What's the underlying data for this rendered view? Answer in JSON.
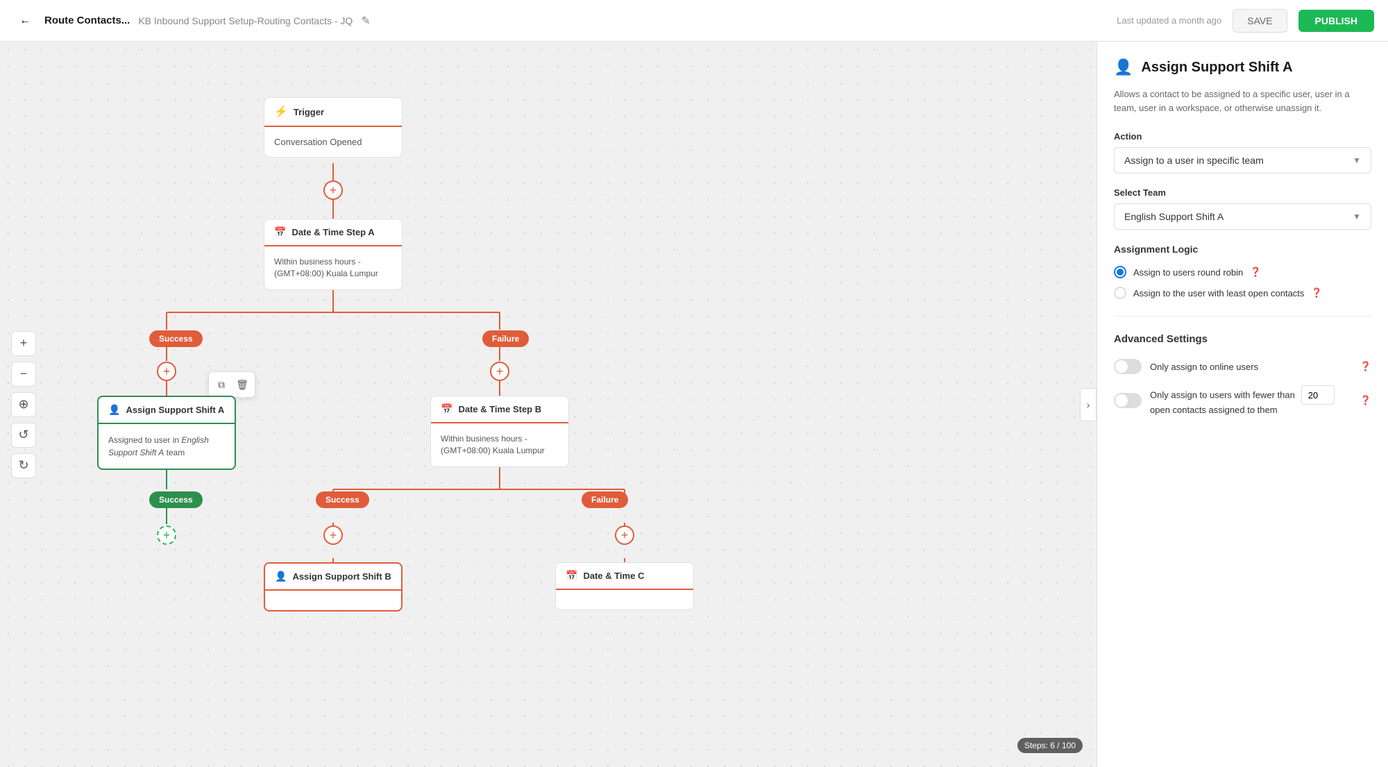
{
  "header": {
    "back_label": "←",
    "page_title": "Route Contacts...",
    "breadcrumb": "KB Inbound Support Setup-Routing Contacts - JQ",
    "edit_icon": "✎",
    "last_updated": "Last updated a month ago",
    "save_label": "SAVE",
    "publish_label": "PUBLISH"
  },
  "canvas": {
    "collapse_icon": "›",
    "steps": "Steps: 6 / 100",
    "toolbar": {
      "zoom_in": "+",
      "zoom_out": "−",
      "center": "⊕",
      "undo": "↺",
      "redo": "↻"
    }
  },
  "nodes": {
    "trigger": {
      "label": "Trigger",
      "body": "Conversation Opened"
    },
    "datetime_a": {
      "label": "Date & Time Step A",
      "body": "Within business hours - (GMT+08:00) Kuala Lumpur"
    },
    "assign_a": {
      "label": "Assign Support Shift A",
      "body_prefix": "Assigned to user in ",
      "body_italic": "English Support Shift A",
      "body_suffix": " team"
    },
    "datetime_b": {
      "label": "Date & Time Step B",
      "body": "Within business hours - (GMT+08:00) Kuala Lumpur"
    },
    "assign_b": {
      "label": "Assign Support Shift B",
      "body": ""
    },
    "datetime_c": {
      "label": "Date & Time C",
      "body": ""
    },
    "badges": {
      "success": "Success",
      "failure": "Failure",
      "success_green": "Success",
      "success2": "Success",
      "failure2": "Failure"
    }
  },
  "right_panel": {
    "icon": "👤",
    "title": "Assign Support Shift A",
    "description": "Allows a contact to be assigned to a specific user, user in a team, user in a workspace, or otherwise unassign it.",
    "action_label": "Action",
    "action_value": "Assign to a user in specific team",
    "select_team_label": "Select Team",
    "select_team_value": "English Support Shift A",
    "assignment_logic_label": "Assignment Logic",
    "radio_options": [
      {
        "id": "round_robin",
        "label": "Assign to users round robin",
        "selected": true
      },
      {
        "id": "least_open",
        "label": "Assign to the user with least open contacts",
        "selected": false
      }
    ],
    "advanced_settings_label": "Advanced Settings",
    "toggle_online_label": "Only assign to online users",
    "toggle_contacts_label": "Only assign to users with fewer than",
    "open_contacts_number": "20",
    "open_contacts_suffix": "open contacts assigned to them"
  }
}
